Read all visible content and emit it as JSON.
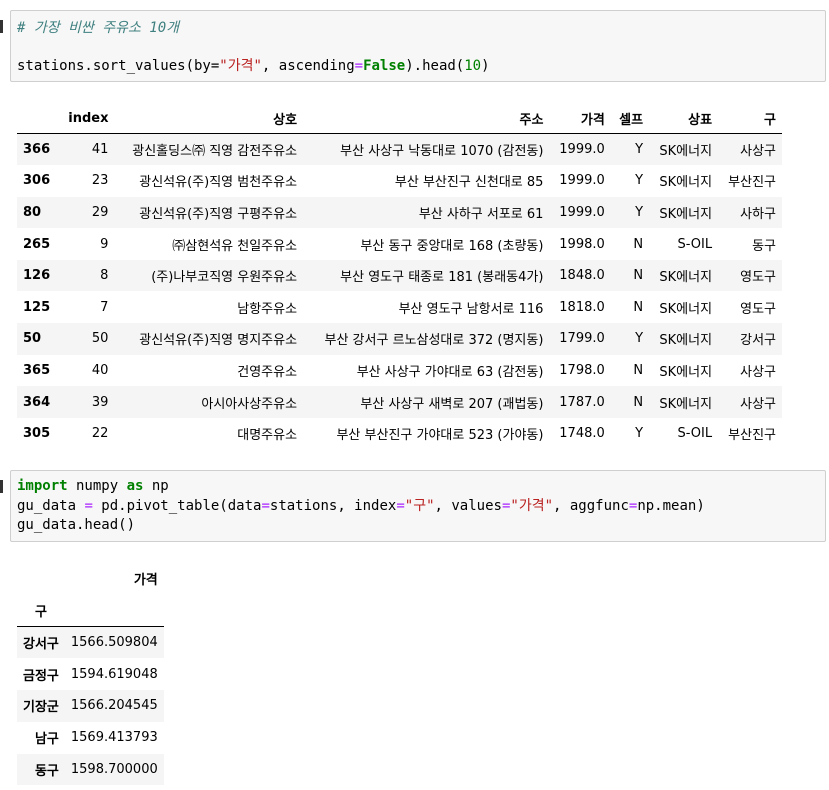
{
  "cell1": {
    "comment": "# 가장 비싼 주유소 10개",
    "code": {
      "obj": "stations.sort_values(by=",
      "str1": "\"가격\"",
      "mid": ", ascending",
      "eq": "=",
      "kw": "False",
      "tail": ").head(",
      "num": "10",
      "end": ")"
    }
  },
  "table1": {
    "columns": [
      "",
      "index",
      "상호",
      "주소",
      "가격",
      "셀프",
      "상표",
      "구"
    ],
    "rows": [
      [
        "366",
        "41",
        "광신홀딩스㈜ 직영 감전주유소",
        "부산 사상구 낙동대로 1070 (감전동)",
        "1999.0",
        "Y",
        "SK에너지",
        "사상구"
      ],
      [
        "306",
        "23",
        "광신석유(주)직영 범천주유소",
        "부산 부산진구 신천대로 85",
        "1999.0",
        "Y",
        "SK에너지",
        "부산진구"
      ],
      [
        "80",
        "29",
        "광신석유(주)직영 구평주유소",
        "부산 사하구 서포로 61",
        "1999.0",
        "Y",
        "SK에너지",
        "사하구"
      ],
      [
        "265",
        "9",
        "㈜삼현석유 천일주유소",
        "부산 동구 중앙대로 168 (초량동)",
        "1998.0",
        "N",
        "S-OIL",
        "동구"
      ],
      [
        "126",
        "8",
        "(주)나부코직영 우원주유소",
        "부산 영도구 태종로 181 (봉래동4가)",
        "1848.0",
        "N",
        "SK에너지",
        "영도구"
      ],
      [
        "125",
        "7",
        "남항주유소",
        "부산 영도구 남항서로 116",
        "1818.0",
        "N",
        "SK에너지",
        "영도구"
      ],
      [
        "50",
        "50",
        "광신석유(주)직영 명지주유소",
        "부산 강서구 르노삼성대로 372 (명지동)",
        "1799.0",
        "Y",
        "SK에너지",
        "강서구"
      ],
      [
        "365",
        "40",
        "건영주유소",
        "부산 사상구 가야대로 63 (감전동)",
        "1798.0",
        "N",
        "SK에너지",
        "사상구"
      ],
      [
        "364",
        "39",
        "아시아사상주유소",
        "부산 사상구 새벽로 207 (괘법동)",
        "1787.0",
        "N",
        "SK에너지",
        "사상구"
      ],
      [
        "305",
        "22",
        "대명주유소",
        "부산 부산진구 가야대로 523 (가야동)",
        "1748.0",
        "Y",
        "S-OIL",
        "부산진구"
      ]
    ]
  },
  "cell2": {
    "line1": {
      "kw1": "import",
      "mod": " numpy ",
      "kw2": "as",
      "alias": " np"
    },
    "line2": {
      "a": "gu_data ",
      "eq": "=",
      "b": " pd.pivot_table(data",
      "eq2": "=",
      "c": "stations, index",
      "eq3": "=",
      "s1": "\"구\"",
      "d": ", values",
      "eq4": "=",
      "s2": "\"가격\"",
      "e": ", aggfunc",
      "eq5": "=",
      "f": "np.mean)"
    },
    "line3": "gu_data.head()"
  },
  "table2": {
    "value_header": "가격",
    "index_header": "구",
    "rows": [
      [
        "강서구",
        "1566.509804"
      ],
      [
        "금정구",
        "1594.619048"
      ],
      [
        "기장군",
        "1566.204545"
      ],
      [
        "남구",
        "1569.413793"
      ],
      [
        "동구",
        "1598.700000"
      ]
    ]
  }
}
